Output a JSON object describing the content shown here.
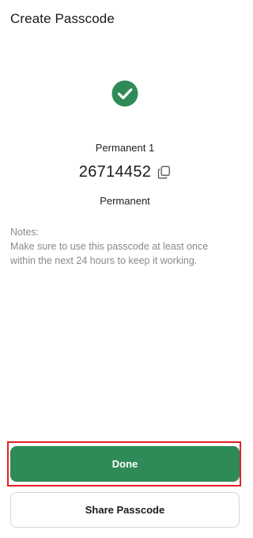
{
  "header": {
    "title": "Create Passcode"
  },
  "status": {
    "icon": "check-circle-icon",
    "color": "#2e8b57"
  },
  "passcode": {
    "name": "Permanent 1",
    "code": "26714452",
    "type": "Permanent",
    "copy_icon": "copy-icon"
  },
  "notes": {
    "heading": "Notes:",
    "line1": "Make sure to use this passcode at least once",
    "line2": "within the next 24 hours to keep it working."
  },
  "actions": {
    "done_label": "Done",
    "share_label": "Share Passcode"
  },
  "colors": {
    "accent": "#2e8b57",
    "highlight": "#e02020",
    "notes_text": "#8a8a8a"
  }
}
